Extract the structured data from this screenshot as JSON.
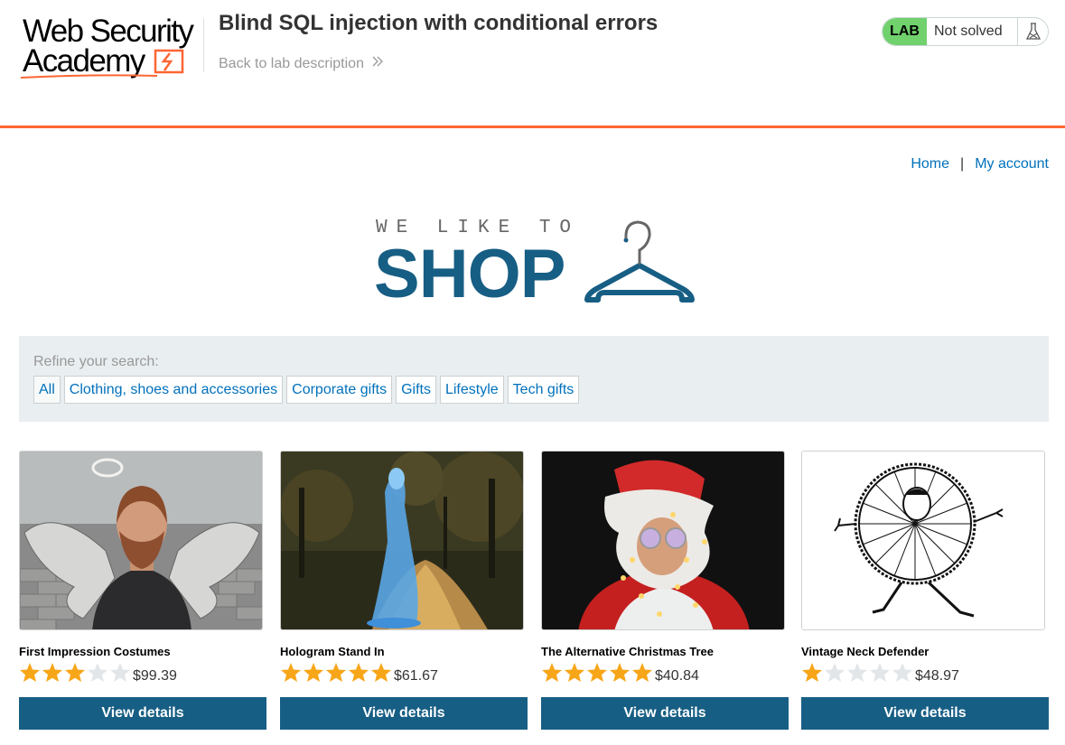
{
  "academy": {
    "logo_line1": "Web Security",
    "logo_line2": "Academy",
    "lab_title": "Blind SQL injection with conditional errors",
    "back_link": "Back to lab description",
    "lab_badge": "LAB",
    "lab_status": "Not solved",
    "accent_color": "#ff6633",
    "badge_color": "#70d16d"
  },
  "nav": {
    "home": "Home",
    "separator": "|",
    "my_account": "My account",
    "link_color": "#0071bc"
  },
  "banner": {
    "tagline": "WE LIKE TO",
    "title": "SHOP",
    "icon": "hanger-icon",
    "brand_color": "#175e84"
  },
  "filter": {
    "label": "Refine your search:",
    "categories": [
      "All",
      "Clothing, shoes and accessories",
      "Corporate gifts",
      "Gifts",
      "Lifestyle",
      "Tech gifts"
    ]
  },
  "products": [
    {
      "name": "First Impression Costumes",
      "rating": 3,
      "price": "$99.39",
      "button": "View details",
      "image": "angel-costume-man"
    },
    {
      "name": "Hologram Stand In",
      "rating": 5,
      "price": "$61.67",
      "button": "View details",
      "image": "blue-hologram-woman"
    },
    {
      "name": "The Alternative Christmas Tree",
      "rating": 5,
      "price": "$40.84",
      "button": "View details",
      "image": "santa-with-lights"
    },
    {
      "name": "Vintage Neck Defender",
      "rating": 1,
      "price": "$48.97",
      "button": "View details",
      "image": "ruff-collar-sketch"
    }
  ],
  "star_colors": {
    "filled": "#f7a619",
    "empty": "#e3e6e8"
  }
}
